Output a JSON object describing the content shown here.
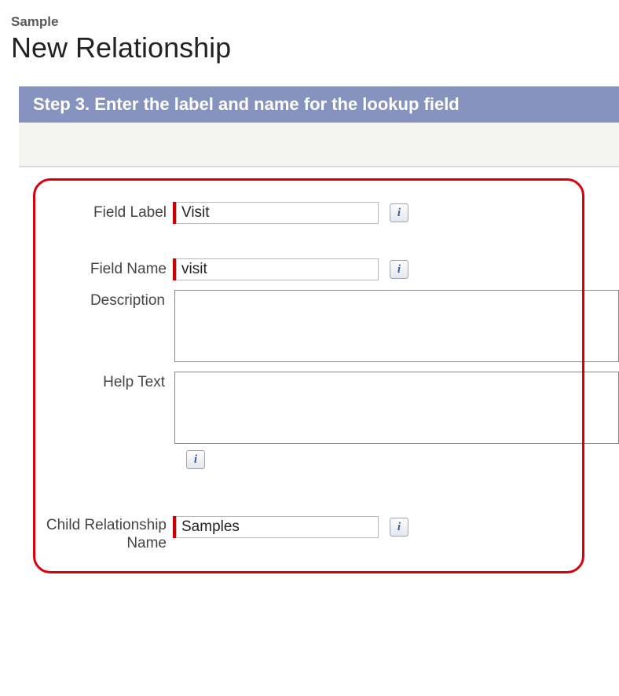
{
  "breadcrumb": "Sample",
  "page_title": "New Relationship",
  "step_header": "Step 3. Enter the label and name for the lookup field",
  "info_glyph": "i",
  "form": {
    "field_label": {
      "label": "Field Label",
      "value": "Visit"
    },
    "field_name": {
      "label": "Field Name",
      "value": "visit"
    },
    "description": {
      "label": "Description",
      "value": ""
    },
    "help_text": {
      "label": "Help Text",
      "value": ""
    },
    "child_rel": {
      "label": "Child Relationship Name",
      "value": "Samples"
    }
  }
}
